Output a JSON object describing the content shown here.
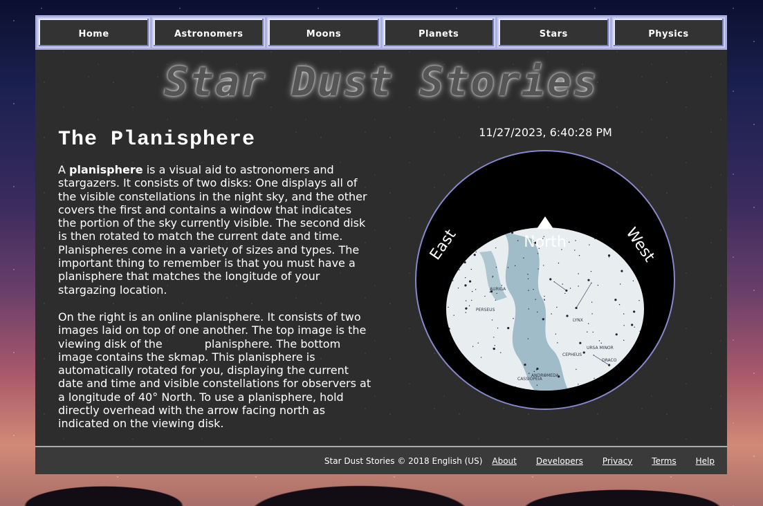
{
  "nav": {
    "items": [
      "Home",
      "Astronomers",
      "Moons",
      "Planets",
      "Stars",
      "Physics"
    ]
  },
  "brand": {
    "title": "Star Dust Stories"
  },
  "page": {
    "title": "The Planisphere",
    "p1_prefix": "A ",
    "p1_bold": "planisphere",
    "p1_rest": " is a visual aid to astronomers and stargazers. It consists of two disks: One displays all of the visible constellations in the night sky, and the other covers the first and contains a window that indicates the portion of the sky currently visible. The second disk is then rotated to match the current date and time. Planispheres come in a variety of sizes and types. The important thing to remember is that you must have a planisphere that matches the longitude of your stargazing location.",
    "p2": "On the right is an online planisphere. It consists of two images laid on top of one another. The top image is the viewing disk of the            planisphere. The bottom image contains the skmap. This planisphere is automatically rotated for you, displaying the current date and time and visible constellations for observers at a longitude of 40° North. To use a planisphere, hold directly overhead with the arrow facing north as indicated on the viewing disk."
  },
  "planisphere": {
    "datetime": "11/27/2023, 6:40:28 PM",
    "north_label": "North",
    "east_label": "East",
    "west_label": "West",
    "sky_color": "#e8eef0",
    "milkyway_color": "#9fbcc8",
    "disk_color": "#000000",
    "constellations": [
      "CASSIOPEIA",
      "CEPHEUS",
      "DRACO",
      "URSA MINOR",
      "PERSEUS",
      "AURIGA",
      "LYNX",
      "ANDROMEDA"
    ]
  },
  "footer": {
    "copyright": "Star Dust Stories © 2018 English (US)",
    "links": [
      "About",
      "Developers",
      "Privacy",
      "Terms",
      "Help"
    ]
  }
}
